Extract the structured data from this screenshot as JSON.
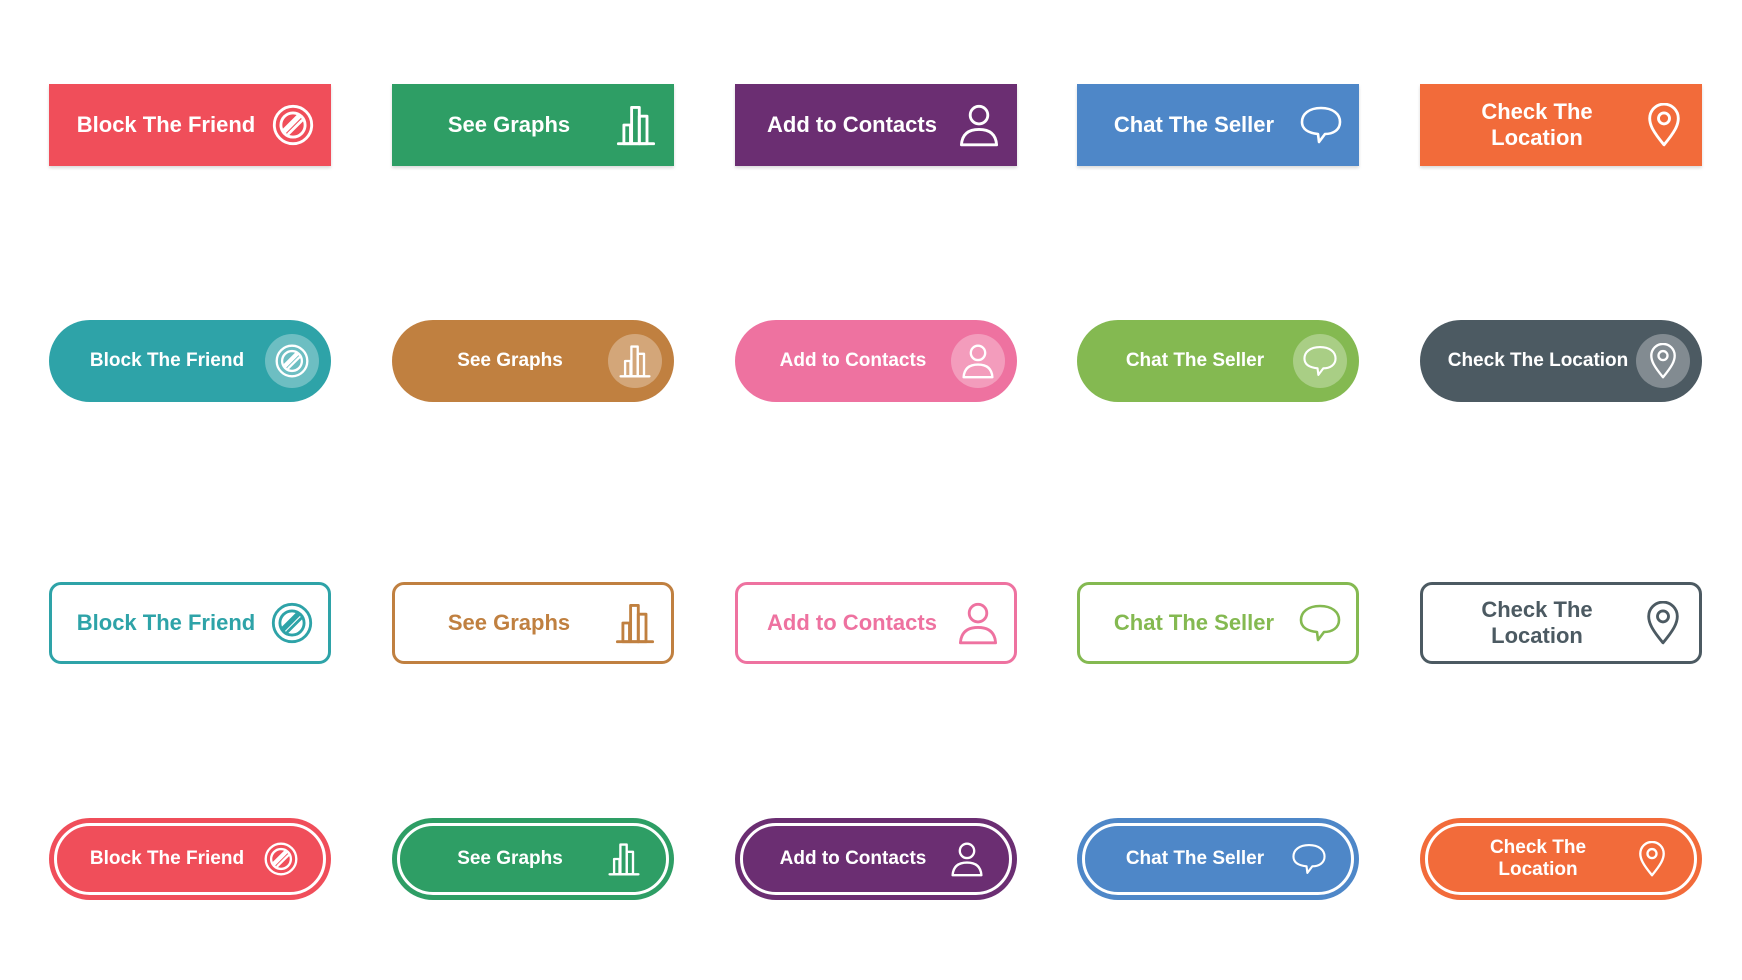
{
  "labels": [
    "Block The Friend",
    "See Graphs",
    "Add to Contacts",
    "Chat The Seller",
    "Check The Location"
  ],
  "icons": [
    "block-icon",
    "bar-chart-icon",
    "user-icon",
    "chat-bubble-icon",
    "location-pin-icon"
  ],
  "rows": [
    {
      "style": "flat-rectangle",
      "colors": [
        "#F04E5A",
        "#2E9E65",
        "#6B2E72",
        "#4E87C8",
        "#F26B3A"
      ]
    },
    {
      "style": "pill-with-icon-circle",
      "colors": [
        "#2EA3A8",
        "#C08040",
        "#EE72A0",
        "#84B951",
        "#4C5A62"
      ]
    },
    {
      "style": "outline-rounded",
      "colors": [
        "#2EA3A8",
        "#C08040",
        "#EE72A0",
        "#84B951",
        "#4C5A62"
      ]
    },
    {
      "style": "pill-double-border",
      "colors": [
        "#F04E5A",
        "#2E9E65",
        "#6B2E72",
        "#4E87C8",
        "#F26B3A"
      ]
    }
  ]
}
